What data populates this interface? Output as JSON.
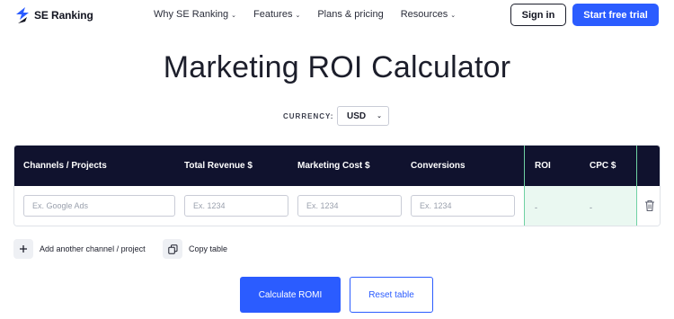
{
  "nav": {
    "brand": "SE Ranking",
    "menu": [
      {
        "label": "Why SE Ranking",
        "has_dropdown": true
      },
      {
        "label": "Features",
        "has_dropdown": true
      },
      {
        "label": "Plans & pricing",
        "has_dropdown": false
      },
      {
        "label": "Resources",
        "has_dropdown": true
      }
    ],
    "signin_label": "Sign in",
    "trial_label": "Start free trial"
  },
  "page": {
    "title": "Marketing ROI Calculator"
  },
  "currency": {
    "label": "CURRENCY:",
    "value": "USD"
  },
  "table": {
    "columns": {
      "channel": "Channels / Projects",
      "revenue": "Total Revenue $",
      "cost": "Marketing Cost $",
      "conversions": "Conversions",
      "roi": "ROI",
      "cpc": "CPC $"
    },
    "row": {
      "channel_placeholder": "Ex. Google Ads",
      "revenue_placeholder": "Ex. 1234",
      "cost_placeholder": "Ex. 1234",
      "conversions_placeholder": "Ex. 1234",
      "roi_value": "-",
      "cpc_value": "-"
    }
  },
  "actions": {
    "add_label": "Add another channel / project",
    "copy_label": "Copy table"
  },
  "buttons": {
    "calculate_label": "Calculate ROMI",
    "reset_label": "Reset table"
  },
  "colors": {
    "accent": "#2b5cff",
    "table_header": "#10122e",
    "results_bg": "#eaf8f1",
    "results_border": "#6fd1a3"
  },
  "icons": {
    "logo": "se-ranking-logo-icon",
    "dropdown": "chevron-down-icon",
    "delete": "trash-icon",
    "add": "plus-icon",
    "copy": "copy-icon"
  }
}
